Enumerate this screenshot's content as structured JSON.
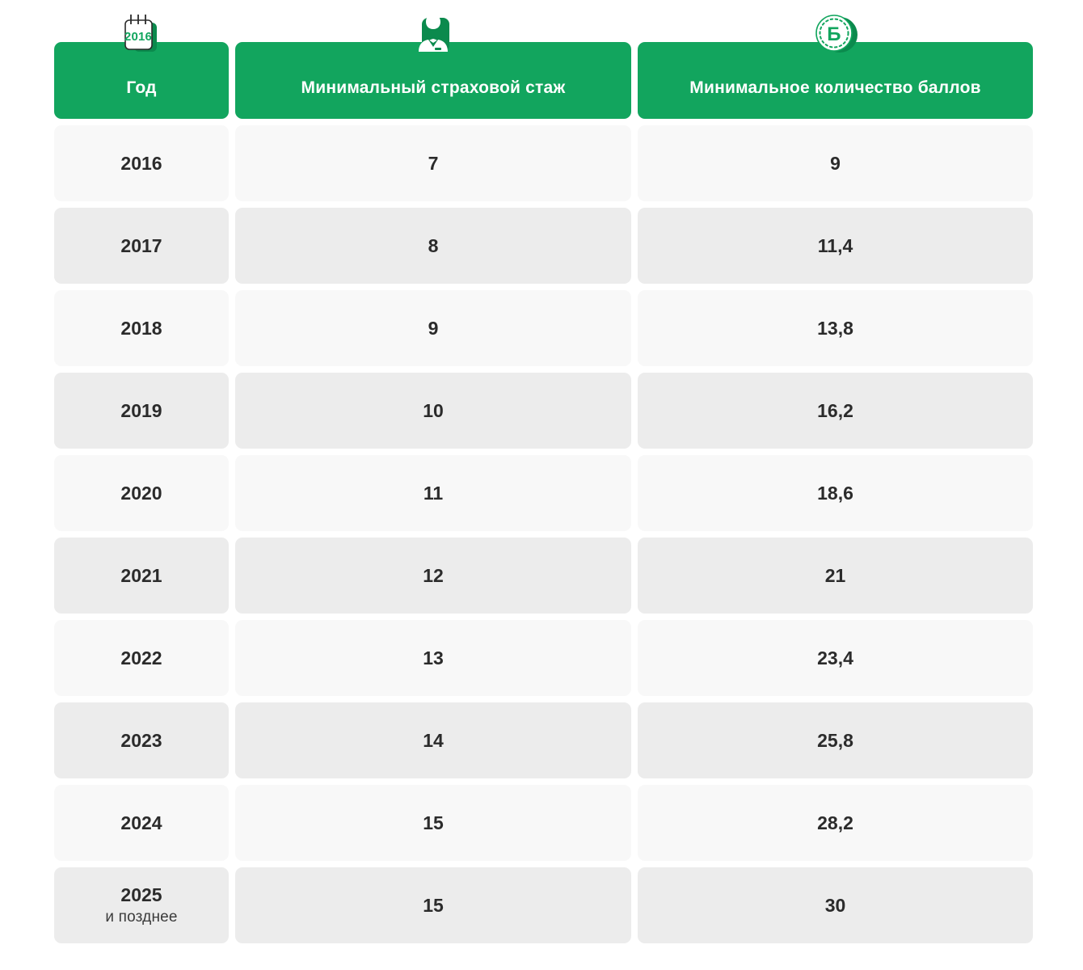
{
  "theme": {
    "accent_green": "#12a55e",
    "accent_green_dark": "#0b8a4d",
    "row_light": "#f8f8f8",
    "row_dark": "#ececec",
    "text_dark": "#2b2b2b",
    "header_text": "#ffffff",
    "page_background": "#ffffff"
  },
  "table": {
    "columns": [
      {
        "label": "Год",
        "icon": "calendar-icon",
        "icon_label": "2016"
      },
      {
        "label": "Минимальный страховой стаж",
        "icon": "person-icon"
      },
      {
        "label": "Минимальное количество баллов",
        "icon": "coin-point-icon",
        "icon_label": "Б"
      }
    ],
    "rows": [
      {
        "year": "2016",
        "year_note": "",
        "stage": "7",
        "points": "9"
      },
      {
        "year": "2017",
        "year_note": "",
        "stage": "8",
        "points": "11,4"
      },
      {
        "year": "2018",
        "year_note": "",
        "stage": "9",
        "points": "13,8"
      },
      {
        "year": "2019",
        "year_note": "",
        "stage": "10",
        "points": "16,2"
      },
      {
        "year": "2020",
        "year_note": "",
        "stage": "11",
        "points": "18,6"
      },
      {
        "year": "2021",
        "year_note": "",
        "stage": "12",
        "points": "21"
      },
      {
        "year": "2022",
        "year_note": "",
        "stage": "13",
        "points": "23,4"
      },
      {
        "year": "2023",
        "year_note": "",
        "stage": "14",
        "points": "25,8"
      },
      {
        "year": "2024",
        "year_note": "",
        "stage": "15",
        "points": "28,2"
      },
      {
        "year": "2025",
        "year_note": "и позднее",
        "stage": "15",
        "points": "30"
      }
    ]
  }
}
